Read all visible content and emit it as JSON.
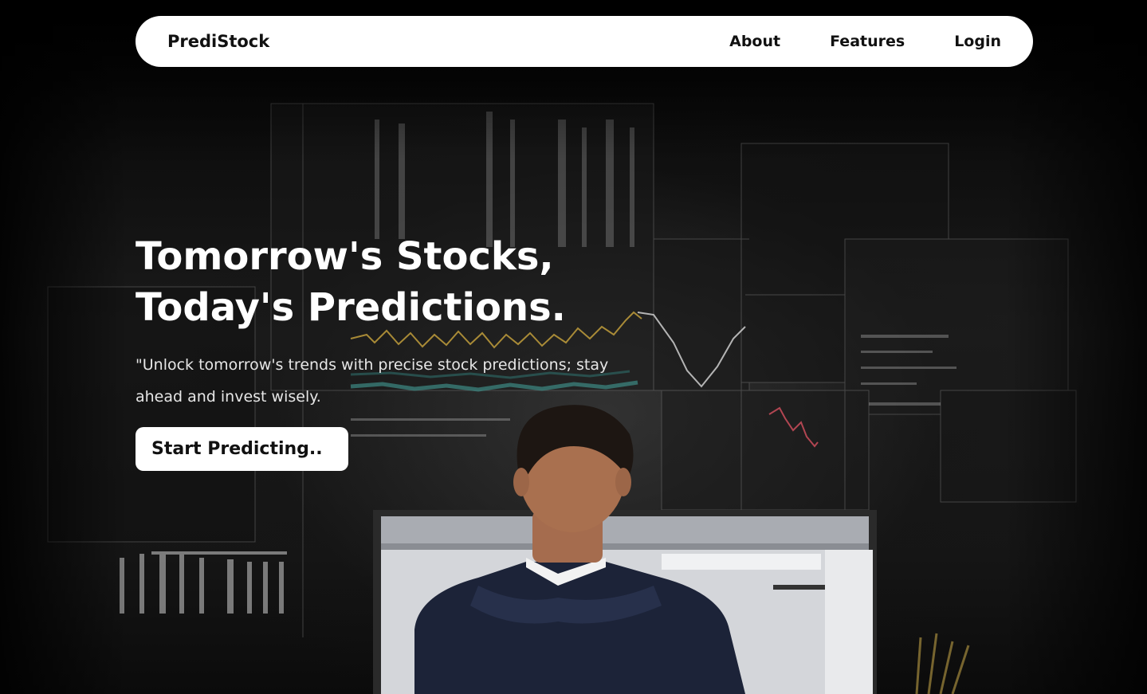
{
  "nav": {
    "brand": "PrediStock",
    "links": [
      "About",
      "Features",
      "Login"
    ]
  },
  "hero": {
    "title_line1": "Tomorrow's Stocks,",
    "title_line2": "Today's Predictions.",
    "subtitle": "\"Unlock tomorrow's trends with precise stock predictions; stay ahead and invest wisely.",
    "cta_label": "Start Predicting.."
  },
  "background": {
    "description_icon": "trader-at-monitor-image",
    "colors": {
      "bg": "#000000",
      "surface": "#ffffff",
      "text_dark": "#111111",
      "text_light": "#ffffff"
    }
  }
}
